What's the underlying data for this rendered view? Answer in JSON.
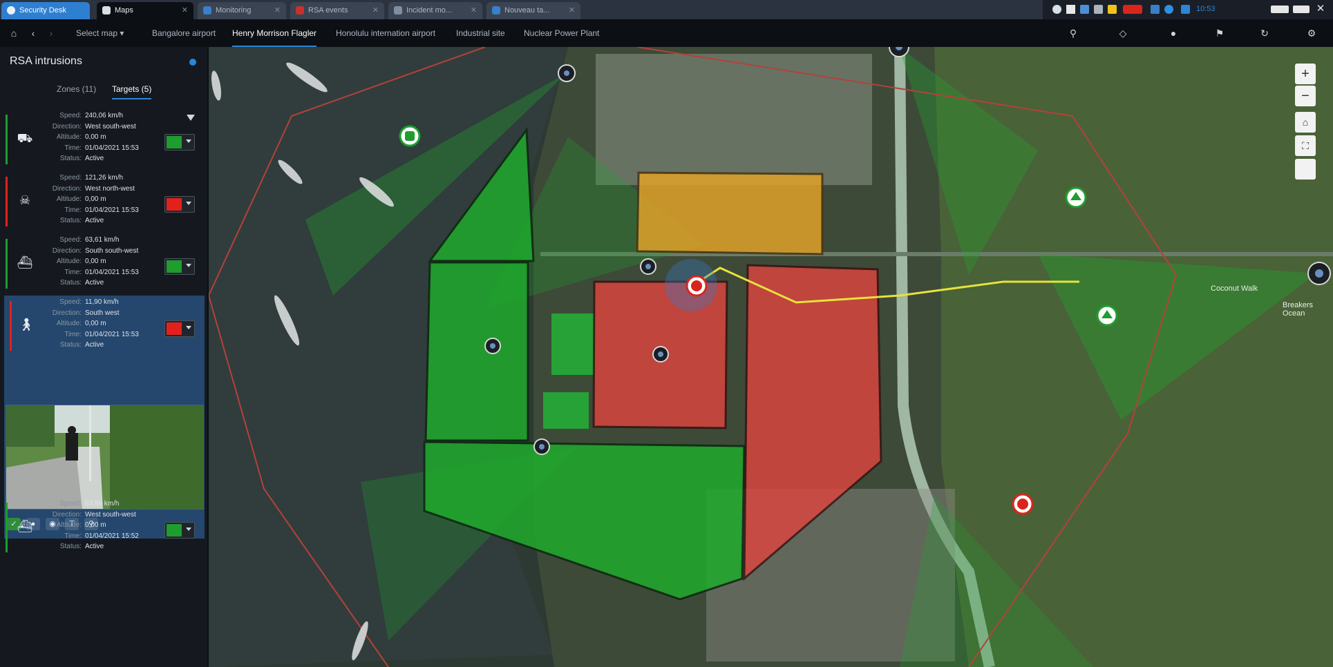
{
  "window": {
    "tabs": [
      {
        "label": "Security Desk",
        "active": false,
        "primary": true
      },
      {
        "label": "Maps",
        "active": true
      },
      {
        "label": "Monitoring",
        "active": false
      },
      {
        "label": "RSA events",
        "active": false
      },
      {
        "label": "Incident mo...",
        "active": false
      },
      {
        "label": "Nouveau ta...",
        "active": false
      }
    ],
    "clock": "10:53"
  },
  "navbar": {
    "select_map": "Select map",
    "maps": [
      {
        "label": "Bangalore airport",
        "active": false
      },
      {
        "label": "Henry Morrison Flagler",
        "active": true
      },
      {
        "label": "Honolulu internation airport",
        "active": false
      },
      {
        "label": "Industrial site",
        "active": false
      },
      {
        "label": "Nuclear Power Plant",
        "active": false
      }
    ]
  },
  "sidebar": {
    "title": "RSA intrusions",
    "tabs": [
      {
        "label": "Zones (11)",
        "active": false
      },
      {
        "label": "Targets (5)",
        "active": true
      }
    ],
    "field_labels": {
      "speed": "Speed:",
      "direction": "Direction:",
      "altitude": "Altitude:",
      "time": "Time:",
      "status": "Status:"
    },
    "targets": [
      {
        "icon": "car-icon",
        "color": "#1f9d2f",
        "speed": "240,06 km/h",
        "direction": "West south-west",
        "altitude": "0,00 m",
        "time": "01/04/2021 15:53",
        "status": "Active"
      },
      {
        "icon": "person-icon",
        "color": "#e2211c",
        "speed": "121,26 km/h",
        "direction": "West north-west",
        "altitude": "0,00 m",
        "time": "01/04/2021 15:53",
        "status": "Active"
      },
      {
        "icon": "vessel-icon",
        "color": "#1f9d2f",
        "speed": "63,61 km/h",
        "direction": "South south-west",
        "altitude": "0,00 m",
        "time": "01/04/2021 15:53",
        "status": "Active"
      },
      {
        "icon": "walker-icon",
        "color": "#e2211c",
        "speed": "11,90 km/h",
        "direction": "South west",
        "altitude": "0,00 m",
        "time": "01/04/2021 15:53",
        "status": "Active"
      },
      {
        "icon": "vessel-icon",
        "color": "#1f9d2f",
        "speed": "83,89 km/h",
        "direction": "West south-west",
        "altitude": "0,00 m",
        "time": "01/04/2021 15:52",
        "status": "Active"
      }
    ]
  },
  "map": {
    "labels": {
      "walk": "Coconut Walk",
      "breakers": "Breakers Ocean"
    }
  },
  "colors": {
    "accent": "#2a86d8",
    "zone_green": "#1faa2c",
    "zone_red": "#e0443f",
    "zone_orange": "#e0a22a",
    "track_yellow": "#e8e23a"
  }
}
